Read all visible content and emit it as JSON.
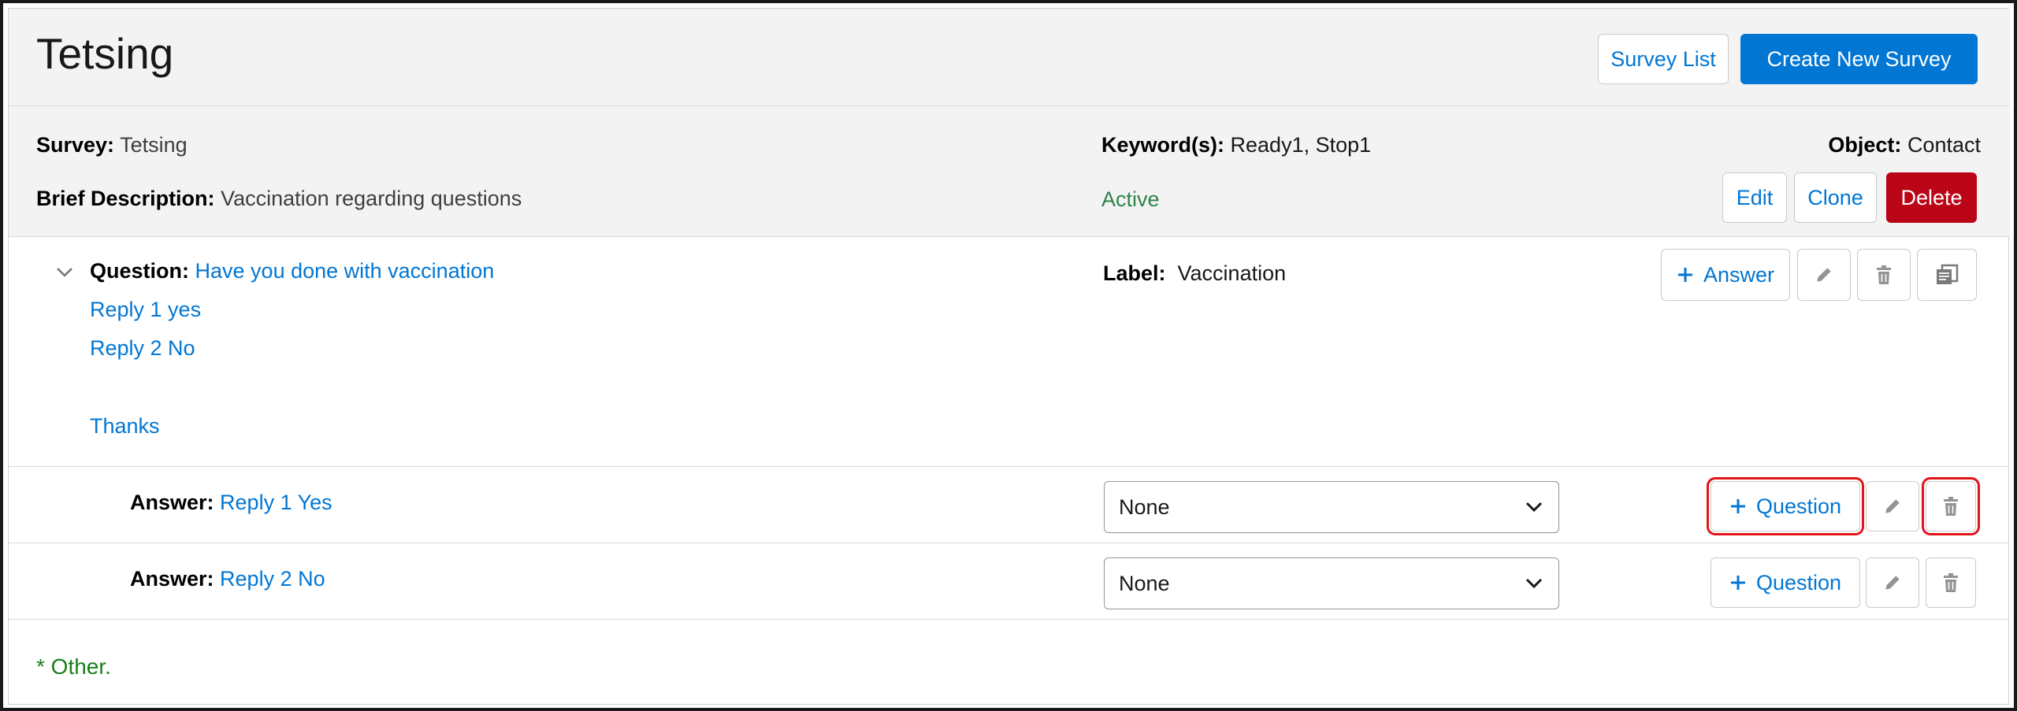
{
  "header": {
    "title": "Tetsing",
    "survey_list_label": "Survey List",
    "create_label": "Create New Survey"
  },
  "summary": {
    "survey_label": "Survey:",
    "survey_value": "Tetsing",
    "keyword_label": "Keyword(s):",
    "keyword_value": "Ready1, Stop1",
    "object_label": "Object:",
    "object_value": "Contact",
    "desc_label": "Brief Description:",
    "desc_value": "Vaccination regarding questions",
    "status": "Active",
    "edit_label": "Edit",
    "clone_label": "Clone",
    "delete_label": "Delete"
  },
  "question": {
    "label": "Question:",
    "text": "Have you done with vaccination",
    "lines": [
      "Reply 1 yes",
      "Reply 2 No",
      "Thanks"
    ],
    "label_label": "Label:",
    "label_value": "Vaccination",
    "add_answer_label": "Answer"
  },
  "answers": [
    {
      "label": "Answer:",
      "text": "Reply 1 Yes",
      "select_value": "None",
      "add_question_label": "Question"
    },
    {
      "label": "Answer:",
      "text": "Reply 2 No",
      "select_value": "None",
      "add_question_label": "Question"
    }
  ],
  "footer": {
    "other": "* Other."
  },
  "colors": {
    "brand": "#0176d3",
    "danger": "#ba0517",
    "success": "#2e844a",
    "highlight": "#e3131b"
  },
  "icons": [
    "plus-icon",
    "pencil-icon",
    "trash-icon",
    "copy-icon",
    "chevron-down-icon"
  ]
}
